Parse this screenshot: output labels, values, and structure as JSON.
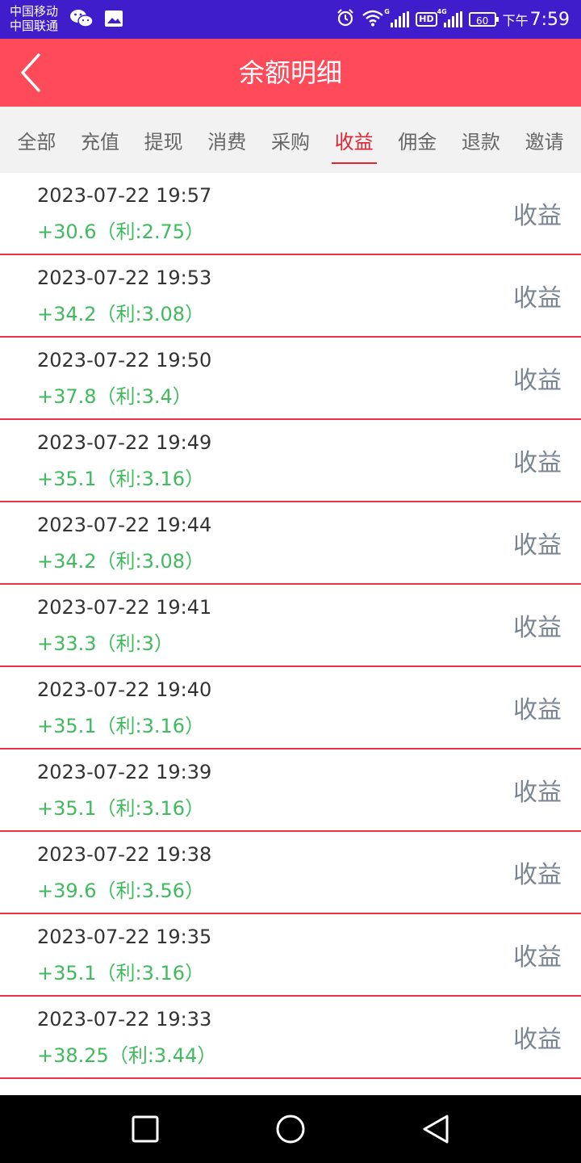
{
  "status_bar": {
    "carrier_1": "中国移动",
    "carrier_2": "中国联通",
    "signal_1_tag": "G",
    "hd": "HD",
    "signal_2_tag": "4G",
    "battery": "60",
    "ampm": "下午",
    "time": "7:59"
  },
  "header": {
    "title": "余额明细"
  },
  "tabs": [
    {
      "label": "全部"
    },
    {
      "label": "充值"
    },
    {
      "label": "提现"
    },
    {
      "label": "消费"
    },
    {
      "label": "采购"
    },
    {
      "label": "收益"
    },
    {
      "label": "佣金"
    },
    {
      "label": "退款"
    },
    {
      "label": "邀请"
    }
  ],
  "active_tab": "收益",
  "records": [
    {
      "time": "2023-07-22 19:57",
      "amount": "+30.6（利:2.75）",
      "type": "收益"
    },
    {
      "time": "2023-07-22 19:53",
      "amount": "+34.2（利:3.08）",
      "type": "收益"
    },
    {
      "time": "2023-07-22 19:50",
      "amount": "+37.8（利:3.4）",
      "type": "收益"
    },
    {
      "time": "2023-07-22 19:49",
      "amount": "+35.1（利:3.16）",
      "type": "收益"
    },
    {
      "time": "2023-07-22 19:44",
      "amount": "+34.2（利:3.08）",
      "type": "收益"
    },
    {
      "time": "2023-07-22 19:41",
      "amount": "+33.3（利:3）",
      "type": "收益"
    },
    {
      "time": "2023-07-22 19:40",
      "amount": "+35.1（利:3.16）",
      "type": "收益"
    },
    {
      "time": "2023-07-22 19:39",
      "amount": "+35.1（利:3.16）",
      "type": "收益"
    },
    {
      "time": "2023-07-22 19:38",
      "amount": "+39.6（利:3.56）",
      "type": "收益"
    },
    {
      "time": "2023-07-22 19:35",
      "amount": "+35.1（利:3.16）",
      "type": "收益"
    },
    {
      "time": "2023-07-22 19:33",
      "amount": "+38.25（利:3.44）",
      "type": "收益"
    }
  ],
  "colors": {
    "status_bar": "#3f1dcb",
    "header": "#ff4a5a",
    "active_tab": "#e02434",
    "amount": "#3fbb5e",
    "divider": "#e8334a"
  },
  "nav": {
    "icons": [
      "recents-square-icon",
      "home-circle-icon",
      "back-triangle-icon"
    ]
  }
}
